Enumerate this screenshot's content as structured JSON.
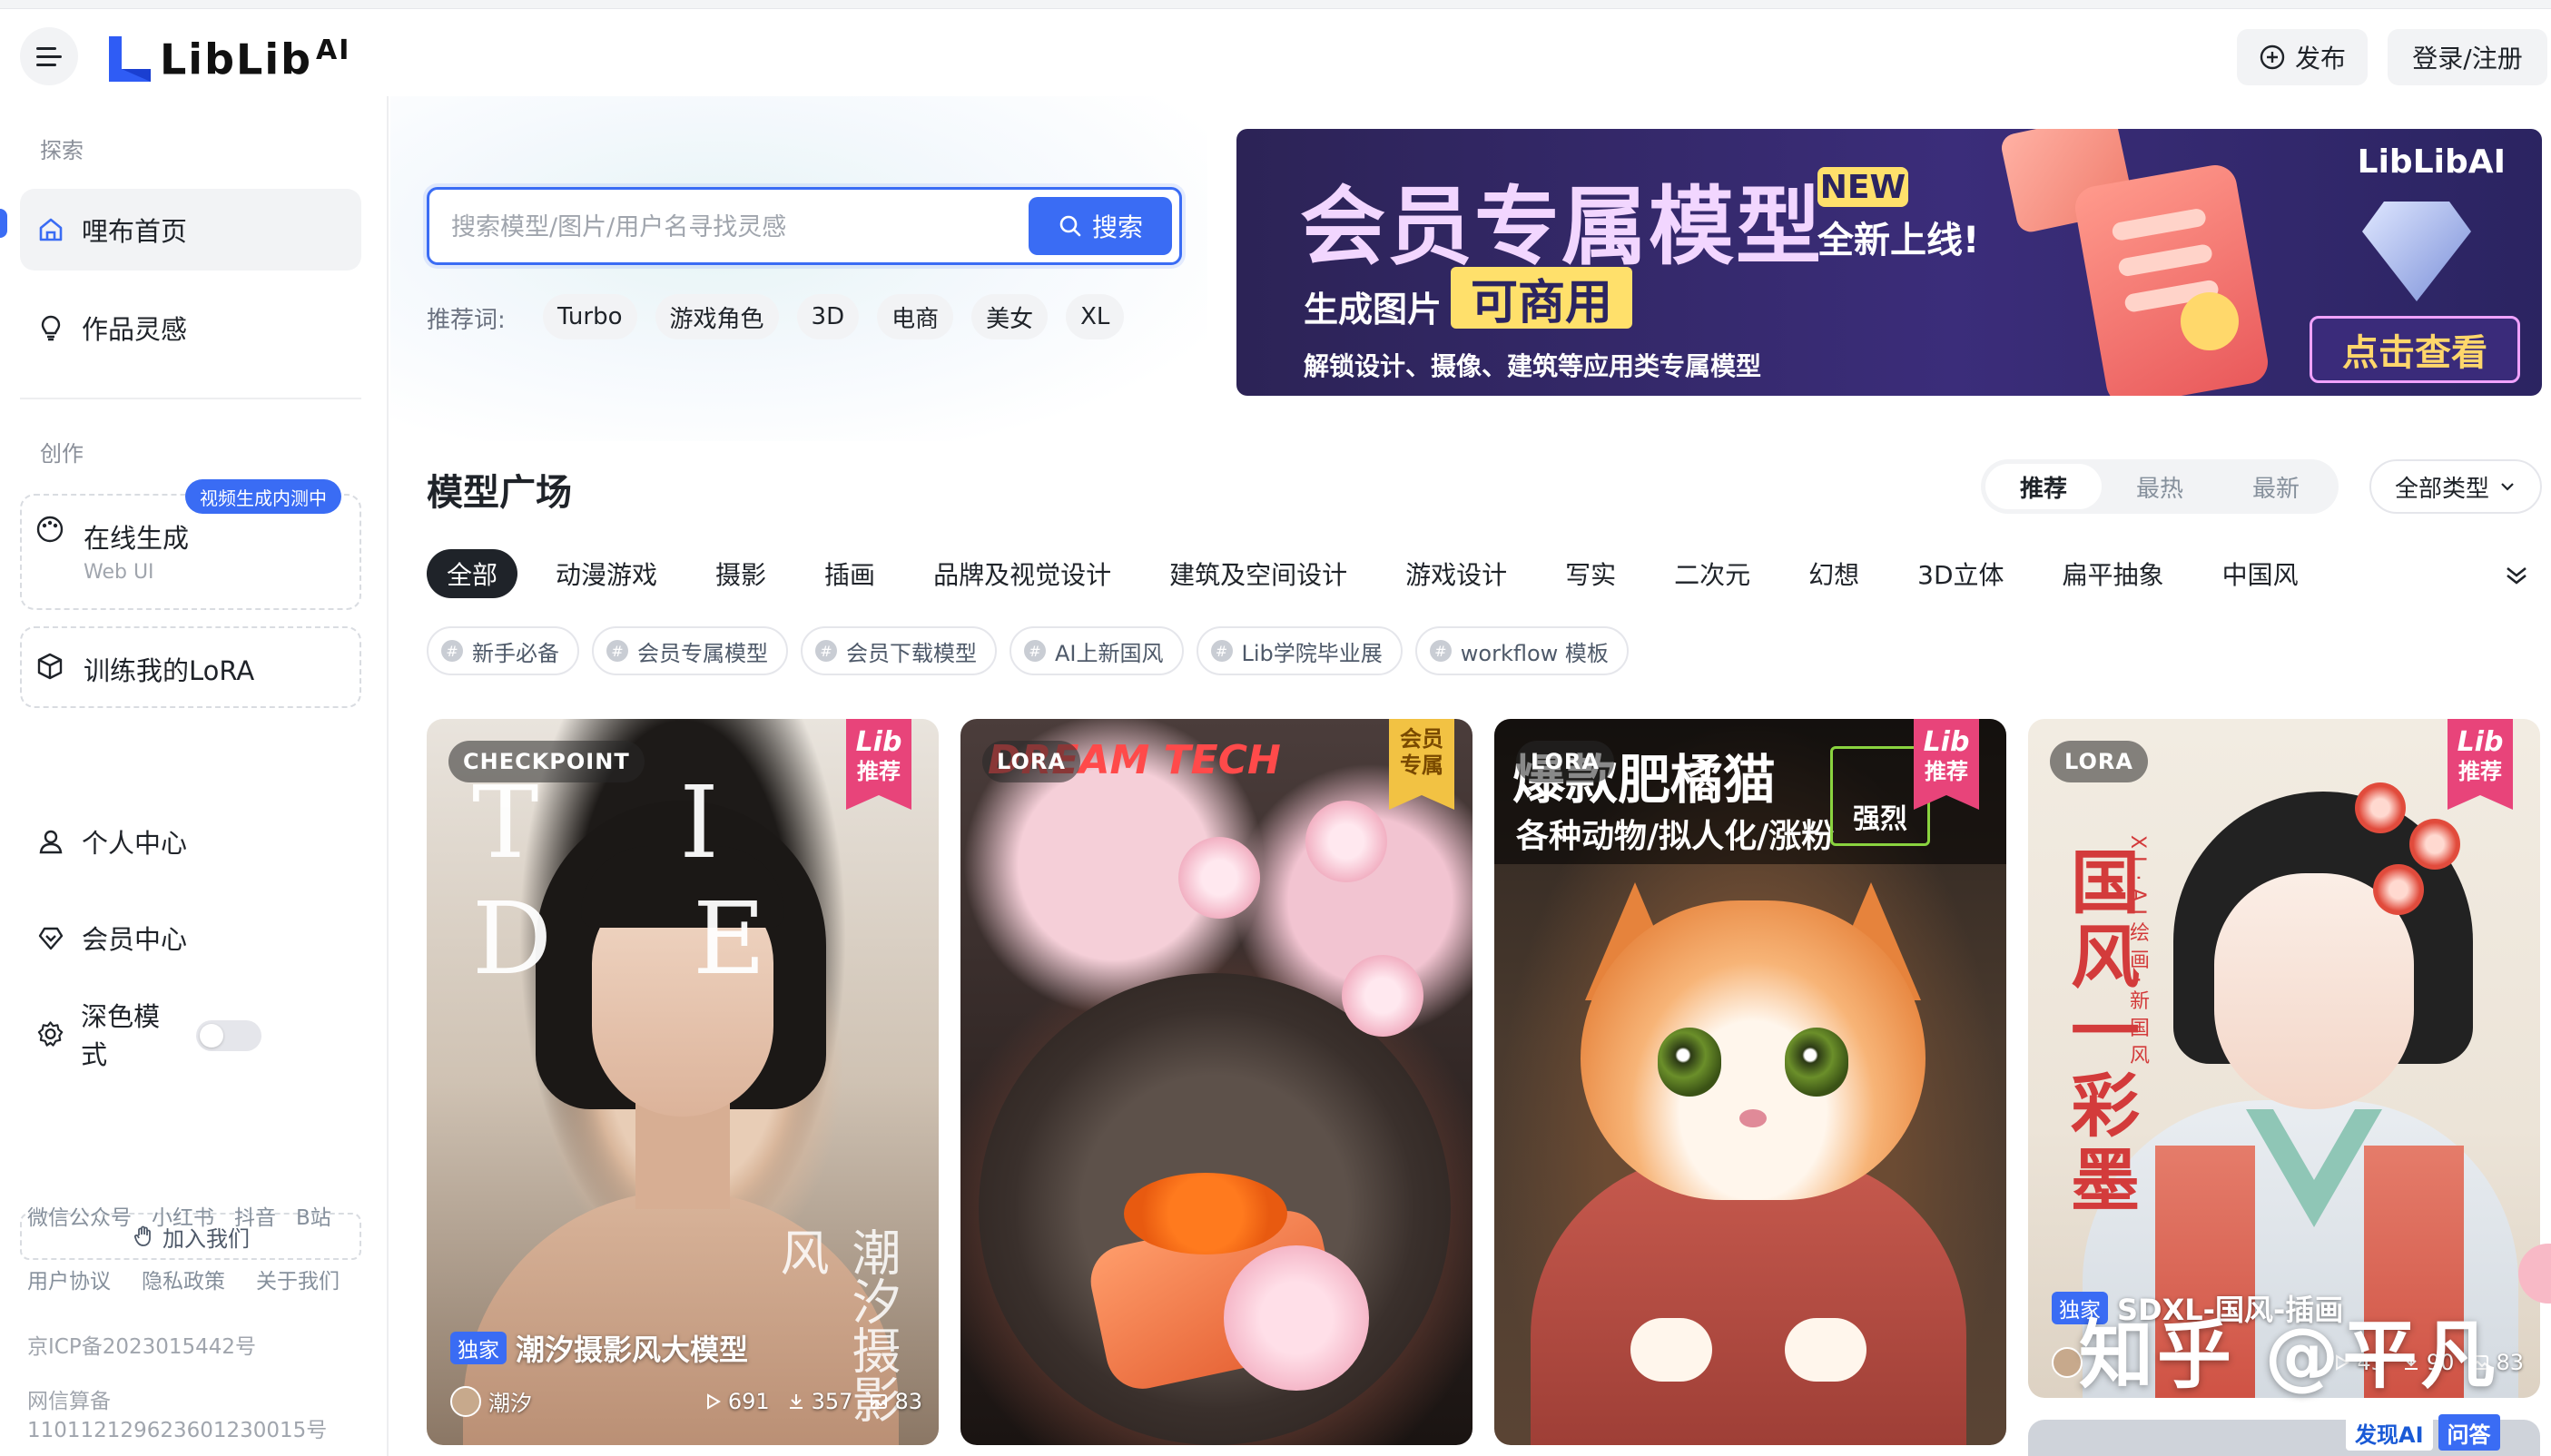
{
  "header": {
    "logo_text": "LibLib",
    "logo_sup": "AI",
    "publish_label": "发布",
    "login_label": "登录/注册"
  },
  "sidebar": {
    "explore_section": "探索",
    "home_label": "哩布首页",
    "inspiration_label": "作品灵感",
    "create_section": "创作",
    "online_gen_title": "在线生成",
    "online_gen_sub": "Web UI",
    "online_gen_badge": "视频生成内测中",
    "train_lora_label": "训练我的LoRA",
    "personal_center": "个人中心",
    "member_center": "会员中心",
    "dark_mode": "深色模式",
    "join_us": "加入我们",
    "social_links": [
      "微信公众号",
      "小红书",
      "抖音",
      "B站"
    ],
    "legal_links": [
      "用户协议",
      "隐私政策",
      "关于我们"
    ],
    "icp": "京ICP备2023015442号",
    "algo_record_label": "网信算备",
    "algo_record_number": "110112129623601230015号"
  },
  "search": {
    "placeholder": "搜索模型/图片/用户名寻找灵感",
    "button_label": "搜索",
    "recommend_label": "推荐词:",
    "recommend_tags": [
      "Turbo",
      "游戏角色",
      "3D",
      "电商",
      "美女",
      "XL"
    ]
  },
  "banner": {
    "title": "会员专属模型",
    "new_badge": "NEW",
    "launch_text": "全新上线!",
    "gen_text": "生成图片",
    "commercial_text": "可商用",
    "desc": "解锁设计、摄像、建筑等应用类专属模型",
    "logo": "LibLibAI",
    "cta": "点击查看"
  },
  "models": {
    "section_title": "模型广场",
    "sort_options": [
      "推荐",
      "最热",
      "最新"
    ],
    "sort_active": "推荐",
    "type_select": "全部类型",
    "categories": [
      "全部",
      "动漫游戏",
      "摄影",
      "插画",
      "品牌及视觉设计",
      "建筑及空间设计",
      "游戏设计",
      "写实",
      "二次元",
      "幻想",
      "3D立体",
      "扁平抽象",
      "中国风"
    ],
    "topics": [
      "新手必备",
      "会员专属模型",
      "会员下载模型",
      "AI上新国风",
      "Lib学院毕业展",
      "workflow 模板"
    ],
    "cards": [
      {
        "type": "CHECKPOINT",
        "ribbon_top": "Lib",
        "ribbon_bottom": "推荐",
        "exclusive": "独家",
        "name": "潮汐摄影风大模型",
        "author": "潮汐",
        "views": "691",
        "downloads": "357",
        "images": "83",
        "art_text": "T I D E",
        "art_script": "潮汐摄影风"
      },
      {
        "type": "LORA",
        "ribbon_top": "会员",
        "ribbon_bottom": "专属",
        "art_title": "DREAM TECH"
      },
      {
        "type": "LORA",
        "ribbon_top": "Lib",
        "ribbon_bottom": "推荐",
        "art_line1": "爆款肥橘猫",
        "art_line2": "各种动物/拟人化/涨粉",
        "art_tag": "强烈"
      },
      {
        "type": "LORA",
        "ribbon_top": "Lib",
        "ribbon_bottom": "推荐",
        "exclusive": "独家",
        "name": "SDXL-国风-插画",
        "views": "43",
        "downloads": "90",
        "images": "83",
        "art_title": "国风一彩墨",
        "art_sub": "XL·AI绘画·新国风"
      }
    ]
  },
  "watermark": "知乎 @平凡",
  "corner_logo": {
    "brand": "发现AI",
    "ask": "问答"
  },
  "colors": {
    "accent": "#3a6cf4",
    "ribbon_pink": "#e8447a",
    "ribbon_gold": "#f2c243",
    "banner_bg": "#2c2356"
  }
}
